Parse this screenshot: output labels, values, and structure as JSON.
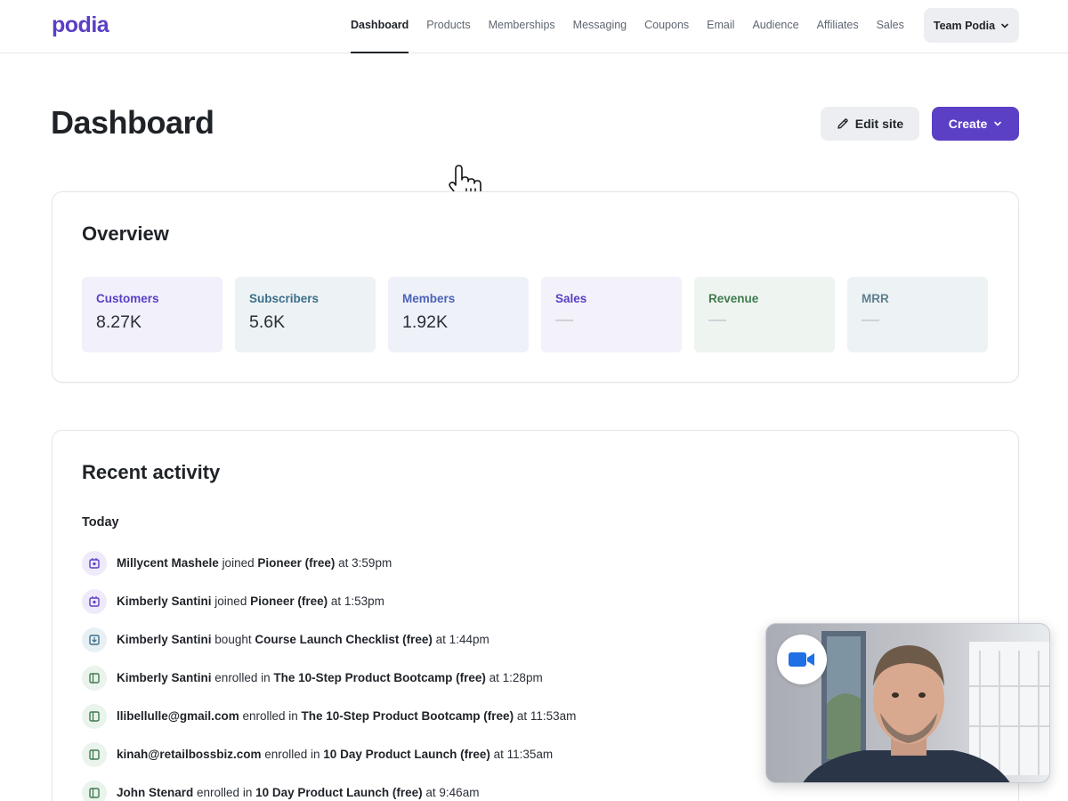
{
  "brand": {
    "logo_text": "podia",
    "accent": "#5b3fc4"
  },
  "nav": {
    "items": [
      {
        "label": "Dashboard",
        "active": true
      },
      {
        "label": "Products"
      },
      {
        "label": "Memberships"
      },
      {
        "label": "Messaging"
      },
      {
        "label": "Coupons"
      },
      {
        "label": "Email"
      },
      {
        "label": "Audience"
      },
      {
        "label": "Affiliates"
      },
      {
        "label": "Sales"
      }
    ],
    "team_label": "Team Podia"
  },
  "header": {
    "title": "Dashboard",
    "edit_label": "Edit site",
    "create_label": "Create"
  },
  "overview": {
    "title": "Overview",
    "stats": [
      {
        "label": "Customers",
        "value": "8.27K",
        "color": "#5b3fc4",
        "bg": "#f2f0fa"
      },
      {
        "label": "Subscribers",
        "value": "5.6K",
        "color": "#3d6f8a",
        "bg": "#edf2f4"
      },
      {
        "label": "Members",
        "value": "1.92K",
        "color": "#4b63b8",
        "bg": "#eef1f7"
      },
      {
        "label": "Sales",
        "value": "",
        "color": "#5b3fc4",
        "bg": "#f3f1f9"
      },
      {
        "label": "Revenue",
        "value": "",
        "color": "#3f7a4f",
        "bg": "#eef4f0"
      },
      {
        "label": "MRR",
        "value": "",
        "color": "#5f7f8e",
        "bg": "#edf3f4"
      }
    ]
  },
  "activity": {
    "title": "Recent activity",
    "group_label": "Today",
    "items": [
      {
        "icon": "membership-icon",
        "kind": "member",
        "who": "Millycent Mashele",
        "verb": "joined",
        "what": "Pioneer (free)",
        "when": "at 3:59pm"
      },
      {
        "icon": "membership-icon",
        "kind": "member",
        "who": "Kimberly Santini",
        "verb": "joined",
        "what": "Pioneer (free)",
        "when": "at 1:53pm"
      },
      {
        "icon": "download-icon",
        "kind": "download",
        "who": "Kimberly Santini",
        "verb": "bought",
        "what": "Course Launch Checklist (free)",
        "when": "at 1:44pm"
      },
      {
        "icon": "course-icon",
        "kind": "course",
        "who": "Kimberly Santini",
        "verb": "enrolled in",
        "what": "The 10-Step Product Bootcamp (free)",
        "when": "at 1:28pm"
      },
      {
        "icon": "course-icon",
        "kind": "course",
        "who": "llibellulle@gmail.com",
        "verb": "enrolled in",
        "what": "The 10-Step Product Bootcamp (free)",
        "when": "at 11:53am"
      },
      {
        "icon": "course-icon",
        "kind": "course",
        "who": "kinah@retailbossbiz.com",
        "verb": "enrolled in",
        "what": "10 Day Product Launch (free)",
        "when": "at 11:35am"
      },
      {
        "icon": "course-icon",
        "kind": "course",
        "who": "John Stenard",
        "verb": "enrolled in",
        "what": "10 Day Product Launch (free)",
        "when": "at 9:46am"
      }
    ]
  },
  "video_overlay": {
    "icon": "video-camera-icon"
  }
}
